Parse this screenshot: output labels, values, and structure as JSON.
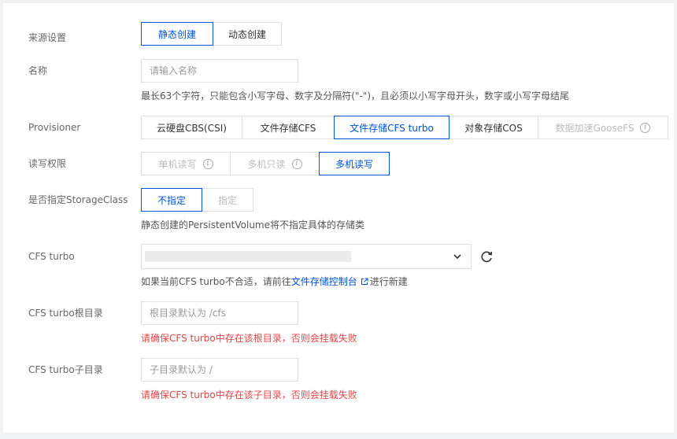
{
  "form": {
    "source": {
      "label": "来源设置",
      "options": [
        "静态创建",
        "动态创建"
      ],
      "selected": 0
    },
    "name": {
      "label": "名称",
      "placeholder": "请输入名称",
      "help": "最长63个字符，只能包含小写字母、数字及分隔符(\"-\")，且必须以小写字母开头，数字或小写字母结尾"
    },
    "provisioner": {
      "label": "Provisioner",
      "options": [
        "云硬盘CBS(CSI)",
        "文件存储CFS",
        "文件存储CFS turbo",
        "对象存储COS",
        "数据加速GooseFS"
      ],
      "selected": 2
    },
    "access": {
      "label": "读写权限",
      "options": [
        "单机读写",
        "多机只读",
        "多机读写"
      ],
      "selected": 2
    },
    "storage_class": {
      "label": "是否指定StorageClass",
      "options": [
        "不指定",
        "指定"
      ],
      "selected": 0,
      "help": "静态创建的PersistentVolume将不指定具体的存储类"
    },
    "cfs_turbo": {
      "label": "CFS turbo",
      "help_prefix": "如果当前CFS turbo不合适，请前往",
      "help_link": "文件存储控制台",
      "help_suffix": "进行新建"
    },
    "root_dir": {
      "label": "CFS turbo根目录",
      "placeholder": "根目录默认为 /cfs",
      "error": "请确保CFS turbo中存在该根目录，否则会挂载失败"
    },
    "sub_dir": {
      "label": "CFS turbo子目录",
      "placeholder": "子目录默认为 /",
      "error": "请确保CFS turbo中存在该子目录，否则会挂载失败"
    }
  },
  "icons": {
    "info": "info-circle-icon",
    "chevron": "chevron-down-icon",
    "refresh": "refresh-icon",
    "external": "external-link-icon"
  },
  "colors": {
    "primary": "#0052d9",
    "error": "#e54545",
    "border": "#dcdfe6"
  }
}
